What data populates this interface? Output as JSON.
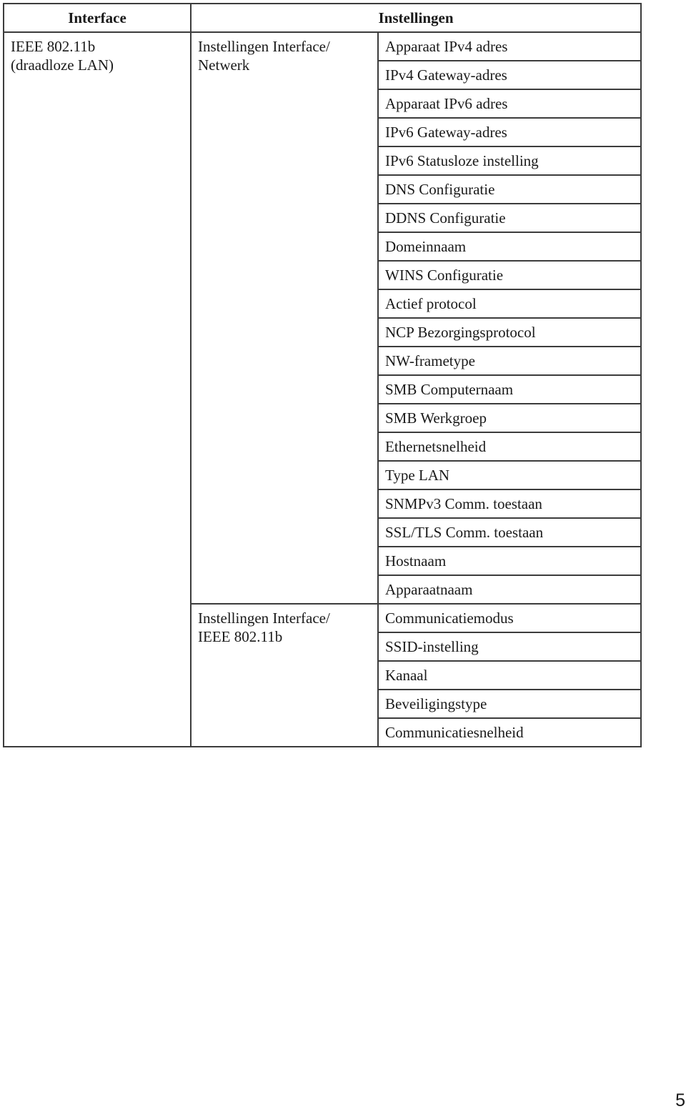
{
  "table": {
    "headers": {
      "interface": "Interface",
      "settings": "Instellingen"
    },
    "interface": {
      "line1": "IEEE 802.11b",
      "line2": "(draadloze LAN)"
    },
    "groups": [
      {
        "line1": "Instellingen Interface/",
        "line2": "Netwerk",
        "items": [
          "Apparaat IPv4 adres",
          "IPv4 Gateway-adres",
          "Apparaat IPv6 adres",
          "IPv6 Gateway-adres",
          "IPv6 Statusloze instelling",
          "DNS Configuratie",
          "DDNS Configuratie",
          "Domeinnaam",
          "WINS Configuratie",
          "Actief protocol",
          "NCP Bezorgingsprotocol",
          "NW-frametype",
          "SMB Computernaam",
          "SMB Werkgroep",
          "Ethernetsnelheid",
          "Type LAN",
          "SNMPv3 Comm. toestaan",
          "SSL/TLS Comm. toestaan",
          "Hostnaam",
          "Apparaatnaam"
        ]
      },
      {
        "line1": "Instellingen Interface/",
        "line2": "IEEE 802.11b",
        "items": [
          "Communicatiemodus",
          "SSID-instelling",
          "Kanaal",
          "Beveiligingstype",
          "Communicatiesnelheid"
        ]
      }
    ]
  },
  "page_number": "5"
}
